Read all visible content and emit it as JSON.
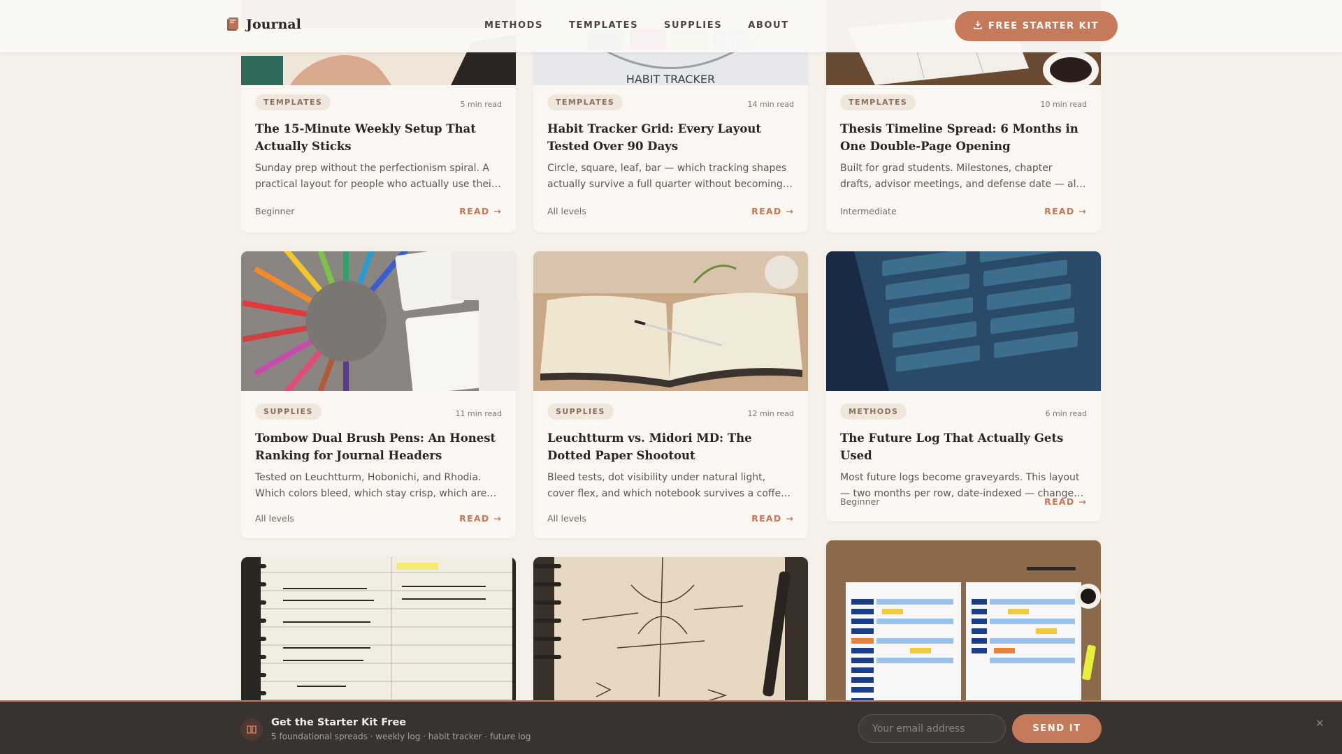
{
  "header": {
    "logo_text": "Journal",
    "nav": [
      "METHODS",
      "TEMPLATES",
      "SUPPLIES",
      "ABOUT"
    ],
    "cta_label": "FREE STARTER KIT",
    "cta_icon": "download-icon"
  },
  "cards": [
    {
      "image": "hand-on-notebook",
      "tag": "TEMPLATES",
      "read_time": "5 min read",
      "title": "The 15-Minute Weekly Setup That Actually Sticks",
      "desc": "Sunday prep without the perfectionism spiral. A practical layout for people who actually use their journal.",
      "level": "Beginner",
      "read_label": "READ →"
    },
    {
      "image": "habit-tracker",
      "image_text": "HABIT TRACKER",
      "tag": "TEMPLATES",
      "read_time": "14 min read",
      "title": "Habit Tracker Grid: Every Layout Tested Over 90 Days",
      "desc": "Circle, square, leaf, bar — which tracking shapes actually survive a full quarter without becoming a chore.",
      "level": "All levels",
      "read_label": "READ →"
    },
    {
      "image": "desk-with-mug",
      "tag": "TEMPLATES",
      "read_time": "10 min read",
      "title": "Thesis Timeline Spread: 6 Months in One Double-Page Opening",
      "desc": "Built for grad students. Milestones, chapter drafts, advisor meetings, and defense date — all in one view.",
      "level": "Intermediate",
      "read_label": "READ →"
    },
    {
      "image": "brush-pens-fan",
      "tag": "SUPPLIES",
      "read_time": "11 min read",
      "title": "Tombow Dual Brush Pens: An Honest Ranking for Journal Headers",
      "desc": "Tested on Leuchtturm, Hobonichi, and Rhodia. Which colors bleed, which stay crisp, which are worth it.",
      "level": "All levels",
      "read_label": "READ →"
    },
    {
      "image": "open-notebook-pen",
      "tag": "SUPPLIES",
      "read_time": "12 min read",
      "title": "Leuchtturm vs. Midori MD: The Dotted Paper Shootout",
      "desc": "Bleed tests, dot visibility under natural light, cover flex, and which notebook survives a coffee spill.",
      "level": "All levels",
      "read_label": "READ →"
    },
    {
      "image": "future-log-screen",
      "tag": "METHODS",
      "read_time": "6 min read",
      "title": "The Future Log That Actually Gets Used",
      "desc": "Most future logs become graveyards. This layout — two months per row, date-indexed — changes that.",
      "level": "Beginner",
      "read_label": "READ →"
    },
    {
      "image": "task-migration-page"
    },
    {
      "image": "thread-sketch-page"
    },
    {
      "image": "weekly-spreadsheet-printout"
    }
  ],
  "footer_bar": {
    "icon": "book-icon",
    "title": "Get the Starter Kit Free",
    "subtitle": "5 foundational spreads · weekly log · habit tracker · future log",
    "email_placeholder": "Your email address",
    "send_label": "SEND IT",
    "close_icon": "close-icon"
  }
}
